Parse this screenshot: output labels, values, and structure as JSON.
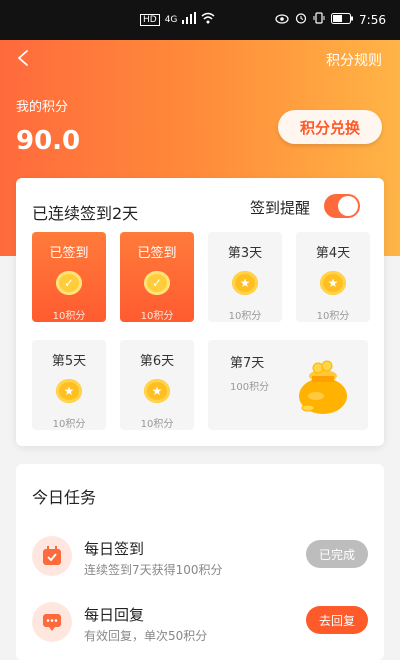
{
  "status_bar": {
    "network": "4G",
    "time": "7:56"
  },
  "header": {
    "rules_label": "积分规则",
    "points_label": "我的积分",
    "points_value": "90.0",
    "exchange_label": "积分兑换"
  },
  "checkin": {
    "title": "已连续签到2天",
    "reminder_label": "签到提醒",
    "reminder_on": true,
    "days": [
      {
        "name": "已签到",
        "points": "10积分",
        "checked": true
      },
      {
        "name": "已签到",
        "points": "10积分",
        "checked": true
      },
      {
        "name": "第3天",
        "points": "10积分",
        "checked": false
      },
      {
        "name": "第4天",
        "points": "10积分",
        "checked": false
      },
      {
        "name": "第5天",
        "points": "10积分",
        "checked": false
      },
      {
        "name": "第6天",
        "points": "10积分",
        "checked": false
      }
    ],
    "day7": {
      "name": "第7天",
      "points": "100积分"
    }
  },
  "tasks": {
    "title": "今日任务",
    "items": [
      {
        "title": "每日签到",
        "desc": "连续签到7天获得100积分",
        "button": "已完成",
        "done": true
      },
      {
        "title": "每日回复",
        "desc": "有效回复，单次50积分",
        "button": "去回复",
        "done": false
      }
    ]
  },
  "colors": {
    "accent": "#ff5a2a",
    "gradient_start": "#ff6a3c",
    "gradient_end": "#ffb446"
  }
}
